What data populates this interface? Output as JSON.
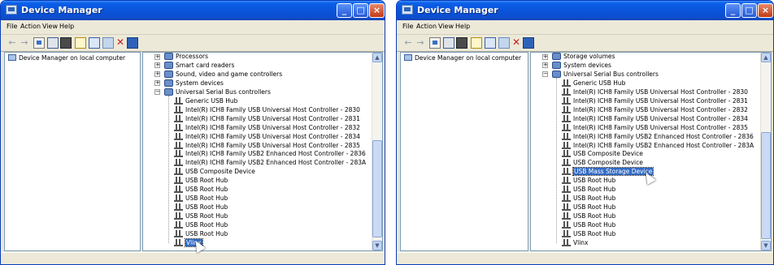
{
  "windows": [
    {
      "title": "Device Manager",
      "menu": [
        "File",
        "Action",
        "View",
        "Help"
      ],
      "tree_root": "Device Manager on local computer",
      "categories": [
        {
          "label": "Processors",
          "expanded": false
        },
        {
          "label": "Smart card readers",
          "expanded": false
        },
        {
          "label": "Sound, video and game controllers",
          "expanded": false
        },
        {
          "label": "System devices",
          "expanded": false
        },
        {
          "label": "Universal Serial Bus controllers",
          "expanded": true
        }
      ],
      "usb_devices": [
        "Generic USB Hub",
        "Intel(R) ICH8 Family USB Universal Host Controller - 2830",
        "Intel(R) ICH8 Family USB Universal Host Controller - 2831",
        "Intel(R) ICH8 Family USB Universal Host Controller - 2832",
        "Intel(R) ICH8 Family USB Universal Host Controller - 2834",
        "Intel(R) ICH8 Family USB Universal Host Controller - 2835",
        "Intel(R) ICH8 Family USB2 Enhanced Host Controller - 2836",
        "Intel(R) ICH8 Family USB2 Enhanced Host Controller - 283A",
        "USB Composite Device",
        "USB Root Hub",
        "USB Root Hub",
        "USB Root Hub",
        "USB Root Hub",
        "USB Root Hub",
        "USB Root Hub",
        "USB Root Hub",
        "Vlinx"
      ],
      "selected": "Vlinx"
    },
    {
      "title": "Device Manager",
      "menu": [
        "File",
        "Action",
        "View",
        "Help"
      ],
      "tree_root": "Device Manager on local computer",
      "categories": [
        {
          "label": "Storage volumes",
          "expanded": false
        },
        {
          "label": "System devices",
          "expanded": false
        },
        {
          "label": "Universal Serial Bus controllers",
          "expanded": true
        }
      ],
      "usb_devices": [
        "Generic USB Hub",
        "Intel(R) ICH8 Family USB Universal Host Controller - 2830",
        "Intel(R) ICH8 Family USB Universal Host Controller - 2831",
        "Intel(R) ICH8 Family USB Universal Host Controller - 2832",
        "Intel(R) ICH8 Family USB Universal Host Controller - 2834",
        "Intel(R) ICH8 Family USB Universal Host Controller - 2835",
        "Intel(R) ICH8 Family USB2 Enhanced Host Controller - 2836",
        "Intel(R) ICH8 Family USB2 Enhanced Host Controller - 283A",
        "USB Composite Device",
        "USB Composite Device",
        "USB Mass Storage Device",
        "USB Root Hub",
        "USB Root Hub",
        "USB Root Hub",
        "USB Root Hub",
        "USB Root Hub",
        "USB Root Hub",
        "USB Root Hub",
        "Vlinx"
      ],
      "selected": "USB Mass Storage Device"
    }
  ],
  "colors": {
    "titlebar": "#0a52d8",
    "selection": "#316ac5",
    "chrome": "#ece9d8"
  }
}
